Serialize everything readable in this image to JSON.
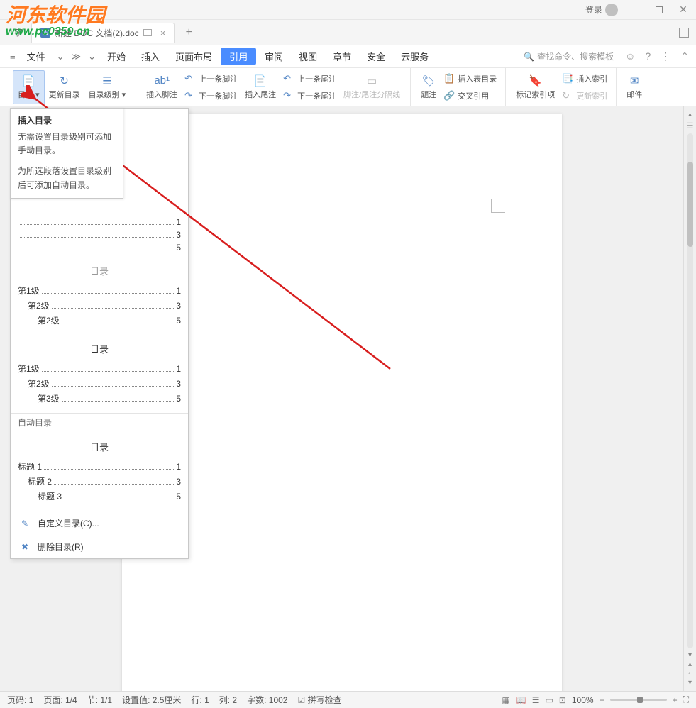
{
  "titlebar": {
    "login": "登录"
  },
  "tab": {
    "doctype": "W",
    "prefix": "字",
    "name": "新建 DOC 文档(2).doc"
  },
  "menu": {
    "file": "文件",
    "items": [
      "开始",
      "插入",
      "页面布局",
      "引用",
      "审阅",
      "视图",
      "章节",
      "安全",
      "云服务"
    ],
    "active_index": 3,
    "search": "查找命令、搜索模板"
  },
  "ribbon": {
    "toc": "目录",
    "update_toc": "更新目录",
    "toc_level": "目录级别",
    "insert_footnote": "插入脚注",
    "prev_footnote": "上一条脚注",
    "next_footnote": "下一条脚注",
    "insert_endnote": "插入尾注",
    "prev_endnote": "上一条尾注",
    "next_endnote": "下一条尾注",
    "fn_separator": "脚注/尾注分隔线",
    "caption": "题注",
    "insert_fig_toc": "插入表目录",
    "cross_ref": "交叉引用",
    "mark_index": "标记索引项",
    "insert_index": "插入索引",
    "update_index": "更新索引",
    "mail": "邮件"
  },
  "tooltip": {
    "title": "插入目录",
    "line1": "无需设置目录级别可添加手动目录。",
    "line2": "为所选段落设置目录级别后可添加自动目录。"
  },
  "dropdown": {
    "label_auto": "自动目录",
    "toc_title": "目录",
    "preview1": [
      {
        "t": "",
        "n": "1"
      },
      {
        "t": "",
        "n": "3"
      },
      {
        "t": "",
        "n": "5"
      }
    ],
    "preview2": [
      {
        "t": "第1级",
        "n": "1",
        "ind": 0
      },
      {
        "t": "第2级",
        "n": "3",
        "ind": 1
      },
      {
        "t": "第2级",
        "n": "5",
        "ind": 2
      }
    ],
    "preview3": [
      {
        "t": "第1级",
        "n": "1",
        "ind": 0
      },
      {
        "t": "第2级",
        "n": "3",
        "ind": 1
      },
      {
        "t": "第3级",
        "n": "5",
        "ind": 2
      }
    ],
    "preview4": [
      {
        "t": "标题 1",
        "n": "1",
        "ind": 0
      },
      {
        "t": "标题 2",
        "n": "3",
        "ind": 1
      },
      {
        "t": "标题 3",
        "n": "5",
        "ind": 2
      }
    ],
    "custom": "自定义目录(C)...",
    "delete": "删除目录(R)"
  },
  "status": {
    "page_no": "页码: 1",
    "page": "页面: 1/4",
    "section": "节: 1/1",
    "setval": "设置值: 2.5厘米",
    "row": "行: 1",
    "col": "列: 2",
    "chars": "字数: 1002",
    "spell": "拼写检查",
    "zoom": "100%"
  },
  "watermark": {
    "line1": "河东软件园",
    "line2": "www.pc0359.cn"
  }
}
